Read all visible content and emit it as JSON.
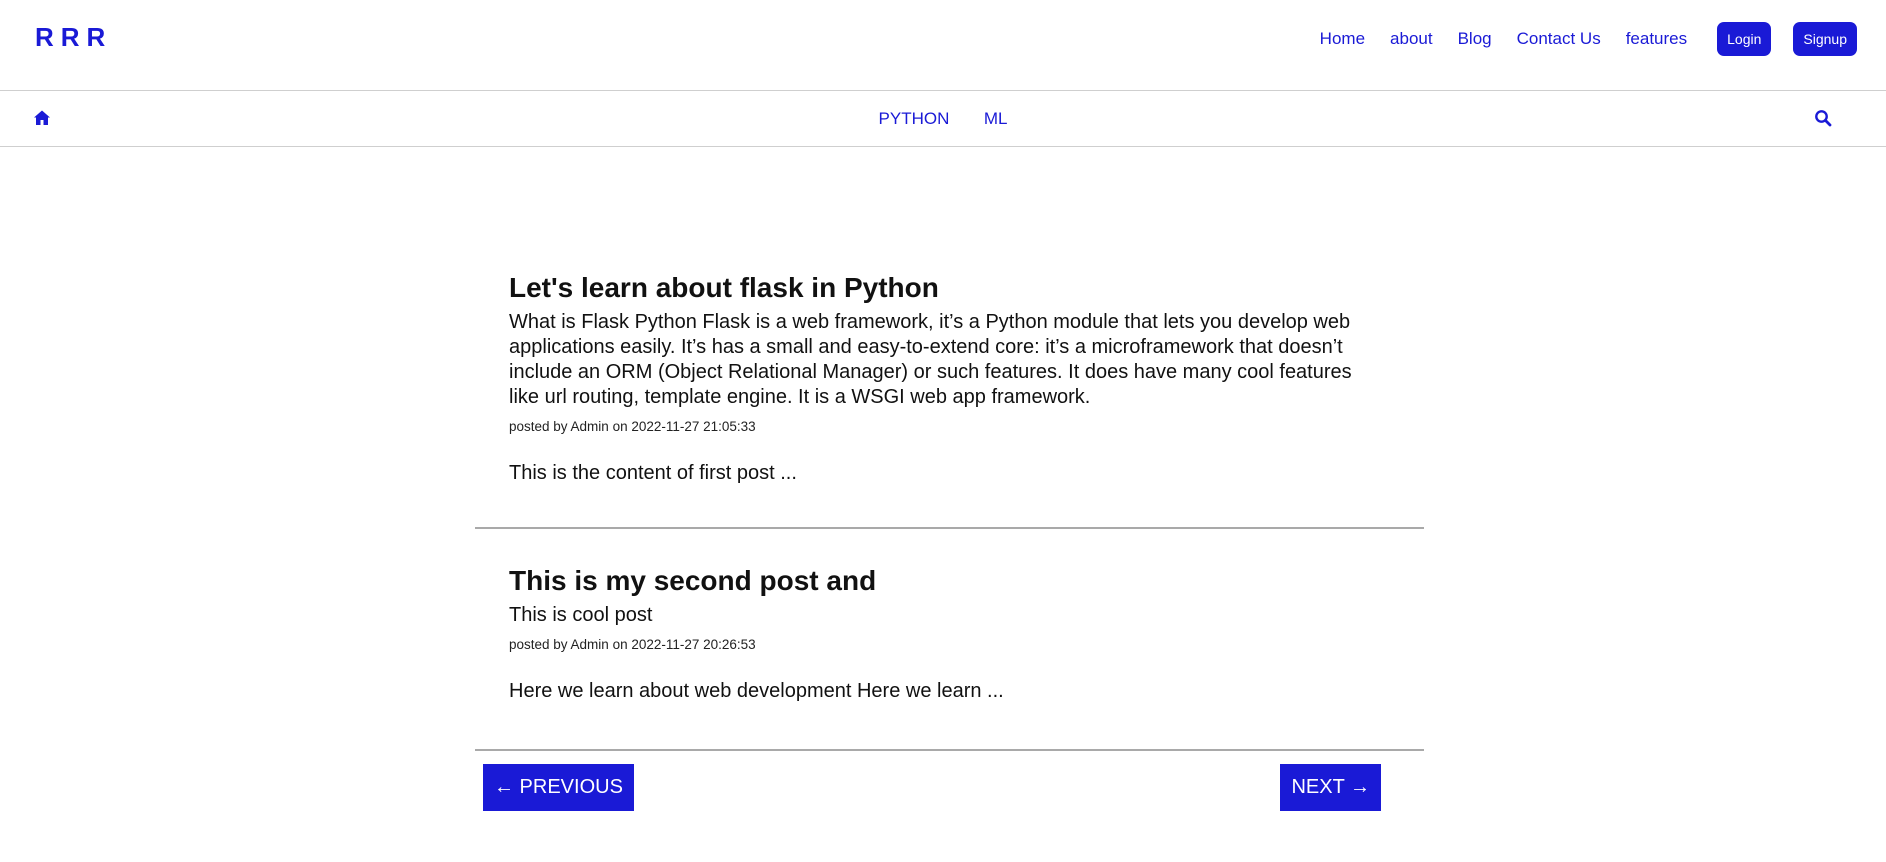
{
  "brand": {
    "logo": "RRR"
  },
  "nav": {
    "links": [
      "Home",
      "about",
      "Blog",
      "Contact Us",
      "features"
    ],
    "login_label": "Login",
    "signup_label": "Signup"
  },
  "subnav": {
    "categories": [
      "PYTHON",
      "ML"
    ]
  },
  "posts": [
    {
      "title": "Let's learn about flask in Python",
      "subtitle": "What is Flask Python Flask is a web framework, it’s a Python module that lets you develop web applications easily. It’s has a small and easy-to-extend core: it’s a microframework that doesn’t include an ORM (Object Relational Manager) or such features. It does have many cool features like url routing, template engine. It is a WSGI web app framework.",
      "meta": "posted by Admin on 2022-11-27 21:05:33",
      "excerpt": "This is the content of first post ..."
    },
    {
      "title": "This is my second post and",
      "subtitle": "This is cool post",
      "meta": "posted by Admin on 2022-11-27 20:26:53",
      "excerpt": "Here we learn about web development Here we learn ..."
    }
  ],
  "pagination": {
    "prev_label": "← PREVIOUS",
    "next_label": "NEXT →"
  },
  "colors": {
    "accent": "#1a1ad6",
    "divider": "#a9a9a9"
  }
}
